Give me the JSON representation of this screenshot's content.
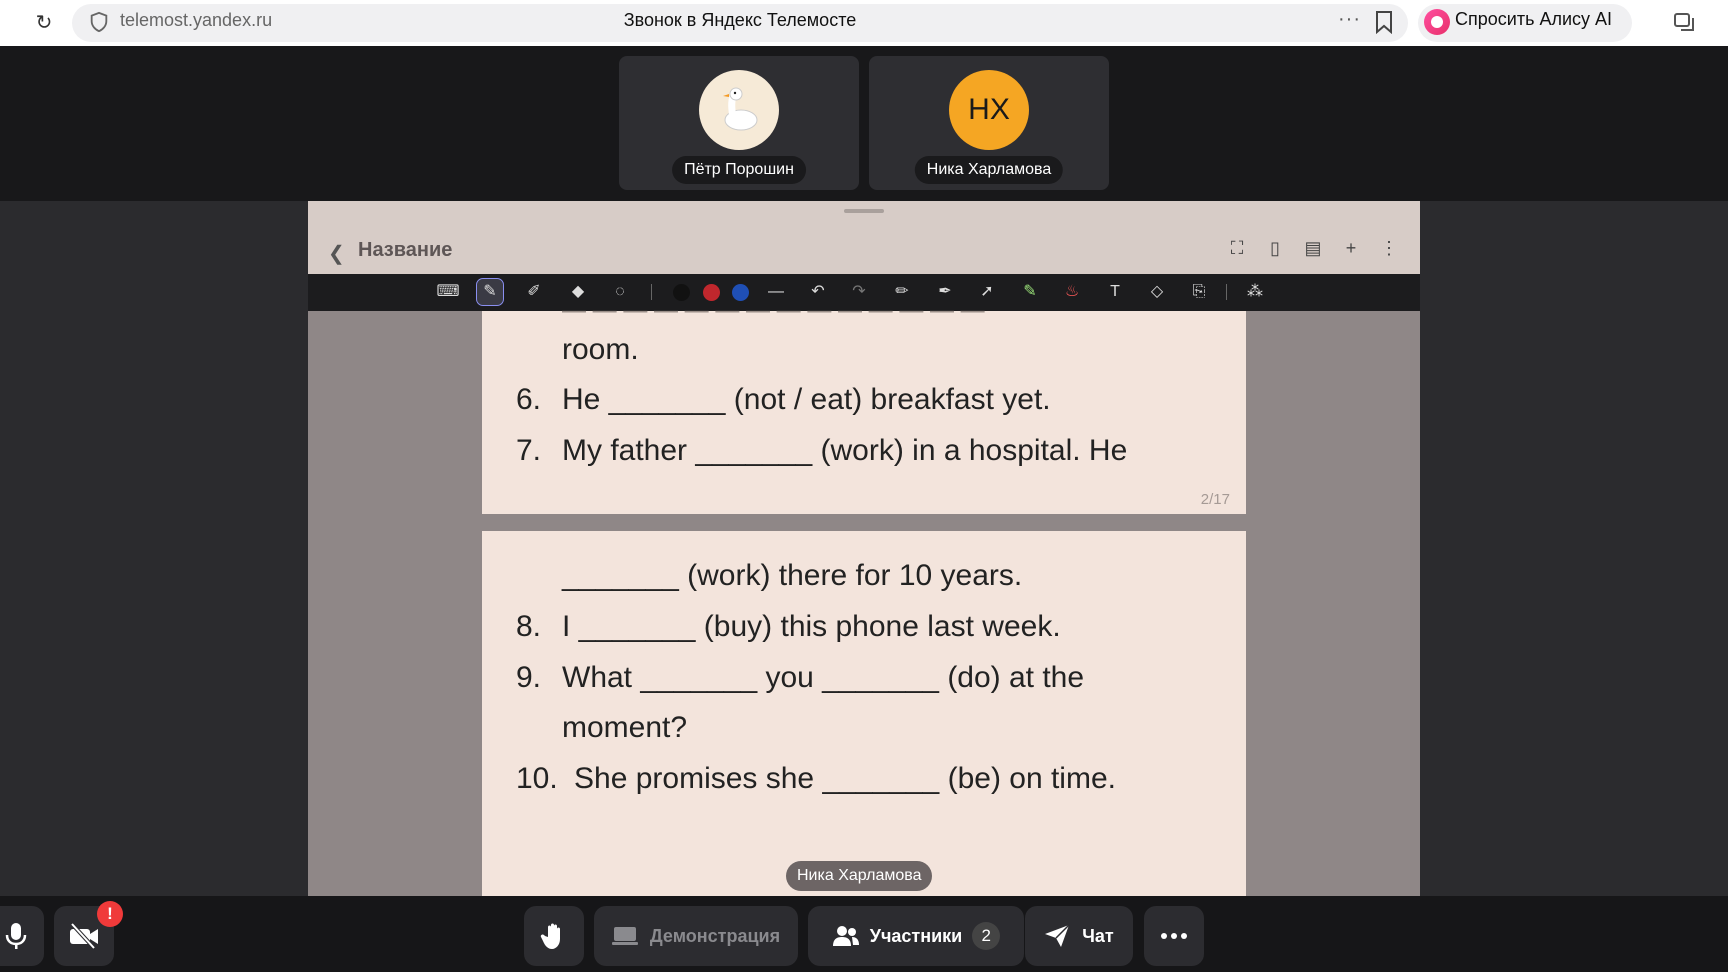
{
  "browser": {
    "url": "telemost.yandex.ru",
    "title": "Звонок в Яндекс Телемосте",
    "alice_label": "Спросить Алису AI",
    "menu_dots": "···"
  },
  "participants": [
    {
      "name": "Пётр Порошин",
      "avatar": "goose-icon"
    },
    {
      "name": "Ника Харламова",
      "initials": "НХ",
      "color": "#f5a623"
    }
  ],
  "board": {
    "title": "Название",
    "page_indicator": "2/17",
    "colors": [
      "#111111",
      "#c0272d",
      "#1f4fb5"
    ]
  },
  "worksheet": {
    "page1_lines": [
      {
        "num": "",
        "text": "room."
      },
      {
        "num": "6.",
        "text": "He _______ (not / eat) breakfast yet."
      },
      {
        "num": "7.",
        "text": "My father _______ (work) in a hospital. He"
      }
    ],
    "page2_lines": [
      {
        "num": "",
        "text": "_______ (work) there for 10 years."
      },
      {
        "num": "8.",
        "text": "I _______ (buy) this phone last week."
      },
      {
        "num": "9.",
        "text": "What _______ you _______ (do) at the"
      },
      {
        "num": "",
        "text": "moment?"
      },
      {
        "num": "10.",
        "text": "She promises she _______ (be) on time."
      }
    ]
  },
  "speaker_label": "Ника Харламова",
  "controls": {
    "demo_label": "Демонстрация",
    "participants_label": "Участники",
    "participants_count": "2",
    "chat_label": "Чат",
    "alert_mark": "!"
  }
}
